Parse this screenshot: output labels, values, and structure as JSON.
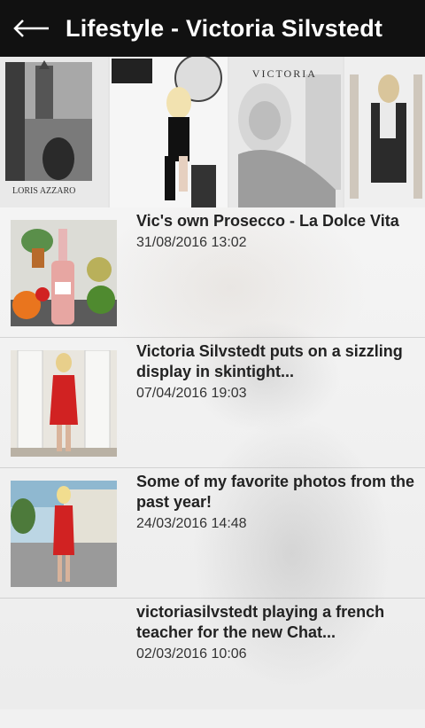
{
  "header": {
    "title": "Lifestyle - Victoria Silvstedt"
  },
  "gallery": {
    "items": [
      {
        "caption": "LORIS AZZARO"
      },
      {
        "caption": ""
      },
      {
        "caption": "VICTORIA"
      },
      {
        "caption": ""
      }
    ]
  },
  "posts": [
    {
      "title": "Vic's own Prosecco - La Dolce Vita",
      "date": "31/08/2016 13:02"
    },
    {
      "title": "Victoria Silvstedt puts on a sizzling display in skintight...",
      "date": "07/04/2016 19:03"
    },
    {
      "title": "Some of my favorite photos from the past year!",
      "date": "24/03/2016 14:48"
    },
    {
      "title": "victoriasilvstedt playing a french teacher for the new Chat...",
      "date": "02/03/2016 10:06"
    }
  ],
  "colors": {
    "header_bg": "#111111",
    "accent_red": "#d12222"
  }
}
